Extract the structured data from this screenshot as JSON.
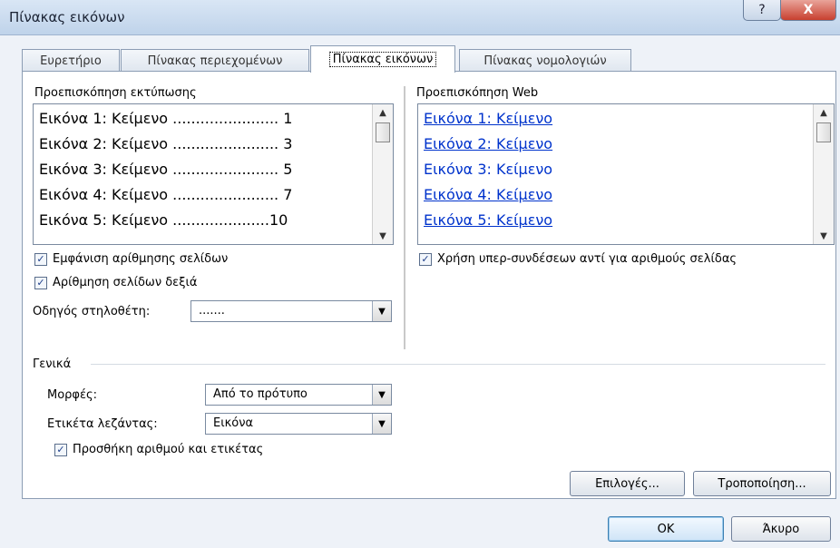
{
  "window": {
    "title": "Πίνακας εικόνων",
    "help_glyph": "?",
    "close_glyph": "X"
  },
  "tabs": [
    {
      "label": "Ευρετήριο"
    },
    {
      "label": "Πίνακας περιεχομένων"
    },
    {
      "label": "Πίνακας εικόνων",
      "active": true
    },
    {
      "label": "Πίνακας νομολογιών"
    }
  ],
  "print_preview": {
    "label": "Προεπισκόπηση εκτύπωσης",
    "rows": [
      "Εικόνα 1: Κείμενο ....................... 1",
      "Εικόνα 2: Κείμενο ....................... 3",
      "Εικόνα 3: Κείμενο ....................... 5",
      "Εικόνα 4: Κείμενο ....................... 7",
      "Εικόνα 5: Κείμενο .....................10"
    ]
  },
  "web_preview": {
    "label": "Προεπισκόπηση Web",
    "rows": [
      "Εικόνα 1: Κείμενο",
      "Εικόνα 2: Κείμενο",
      "Εικόνα 3: Κείμενο",
      "Εικόνα 4: Κείμενο",
      "Εικόνα 5: Κείμενο"
    ]
  },
  "options": {
    "show_page_numbers": {
      "label": "Εμφάνιση αρίθμησης σελίδων",
      "checked": true
    },
    "right_align": {
      "label": "Αρίθμηση σελίδων δεξιά",
      "checked": true
    },
    "tab_leader": {
      "label": "Οδηγός στηλοθέτη:",
      "value": "......."
    },
    "hyperlinks": {
      "label": "Χρήση υπερ-συνδέσεων αντί για αριθμούς σελίδας",
      "checked": true
    }
  },
  "general": {
    "label": "Γενικά",
    "formats": {
      "label": "Μορφές:",
      "value": "Από το πρότυπο"
    },
    "caption_label": {
      "label": "Ετικέτα λεζάντας:",
      "value": "Εικόνα"
    },
    "include_label": {
      "label": "Προσθήκη αριθμού και ετικέτας",
      "checked": true
    }
  },
  "buttons": {
    "options": "Επιλογές...",
    "modify": "Τροποποίηση...",
    "ok": "OK",
    "cancel": "Άκυρο"
  },
  "glyphs": {
    "check": "✓",
    "up": "▲",
    "down": "▼"
  }
}
